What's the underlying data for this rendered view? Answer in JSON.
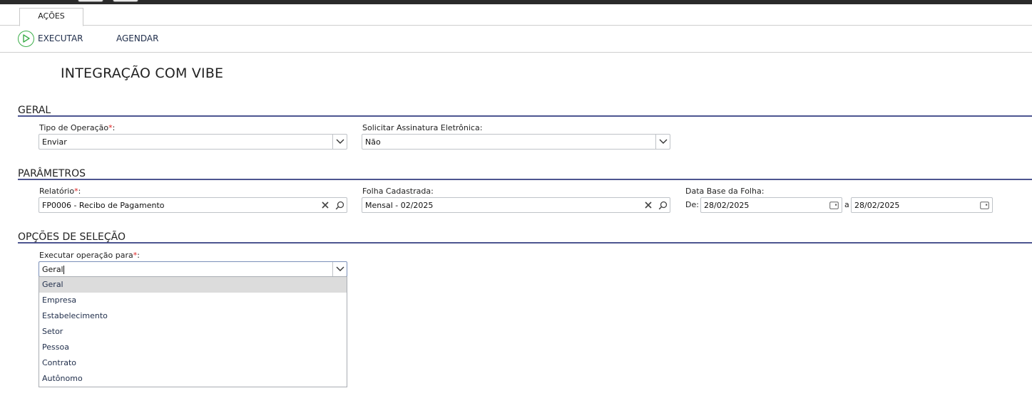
{
  "tabs": [
    {
      "label": "AÇÕES"
    }
  ],
  "toolbar": {
    "execute_label": "EXECUTAR",
    "schedule_label": "AGENDAR"
  },
  "page": {
    "title": "INTEGRAÇÃO COM VIBE"
  },
  "sections": {
    "geral": {
      "title": "GERAL",
      "tipo_operacao": {
        "label": "Tipo de Operação",
        "required_mark": "*",
        "suffix": ":",
        "value": "Enviar"
      },
      "assinatura": {
        "label": "Solicitar Assinatura Eletrônica:",
        "value": "Não"
      }
    },
    "parametros": {
      "title": "PARÂMETROS",
      "relatorio": {
        "label": "Relatório",
        "required_mark": "*",
        "suffix": ":",
        "value": "FP0006 - Recibo de Pagamento"
      },
      "folha": {
        "label": "Folha Cadastrada:",
        "value": "Mensal - 02/2025"
      },
      "data_base": {
        "label": "Data Base da Folha:",
        "from_label": "De:",
        "from_value": "28/02/2025",
        "to_label": "a",
        "to_value": "28/02/2025"
      }
    },
    "opcoes": {
      "title": "OPÇÕES DE SELEÇÃO",
      "executar_para": {
        "label": "Executar operação para",
        "required_mark": "*",
        "suffix": ":",
        "value": "Geral",
        "options": [
          "Geral",
          "Empresa",
          "Estabelecimento",
          "Setor",
          "Pessoa",
          "Contrato",
          "Autônomo"
        ],
        "highlighted": "Geral"
      }
    }
  },
  "colors": {
    "accent_line": "#4d5590",
    "play_green": "#3cae4a",
    "required": "#dd2222"
  },
  "icons": [
    "play-icon",
    "chevron-down-icon",
    "clear-icon",
    "search-icon",
    "calendar-icon"
  ]
}
